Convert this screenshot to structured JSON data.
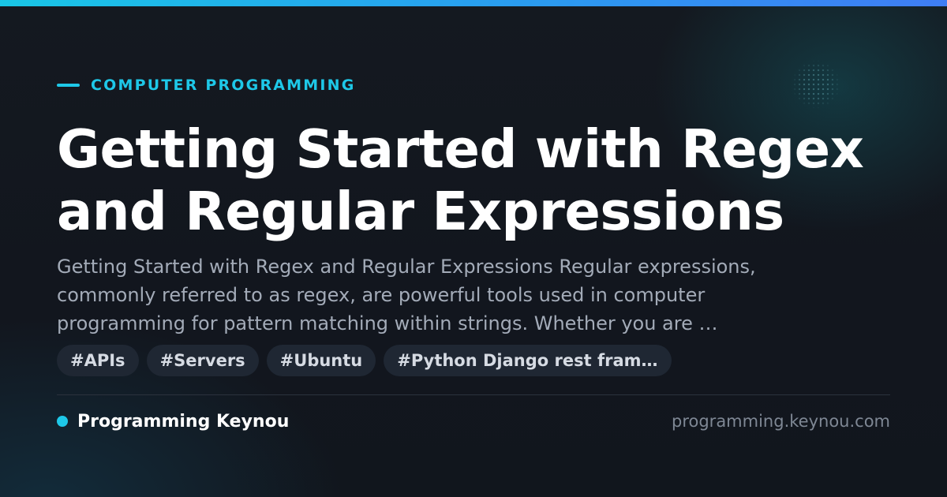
{
  "category": {
    "label": "COMPUTER PROGRAMMING"
  },
  "article": {
    "title_line_1": "Getting Started with Regex",
    "title_line_2": "and Regular Expressions",
    "excerpt_line_1": "Getting Started with Regex and Regular Expressions Regular expressions,",
    "excerpt_line_2": "commonly referred to as regex, are powerful tools used in computer",
    "excerpt_line_3": "programming for pattern matching within strings. Whether you are …"
  },
  "tags": [
    {
      "label": "#APIs"
    },
    {
      "label": "#Servers"
    },
    {
      "label": "#Ubuntu"
    },
    {
      "label": "#Python Django rest fram…"
    }
  ],
  "footer": {
    "brand": "Programming Keynou",
    "domain": "programming.keynou.com"
  },
  "colors": {
    "accent": "#1ec8e8",
    "background": "#12161f",
    "tag_background": "#1f2733"
  }
}
